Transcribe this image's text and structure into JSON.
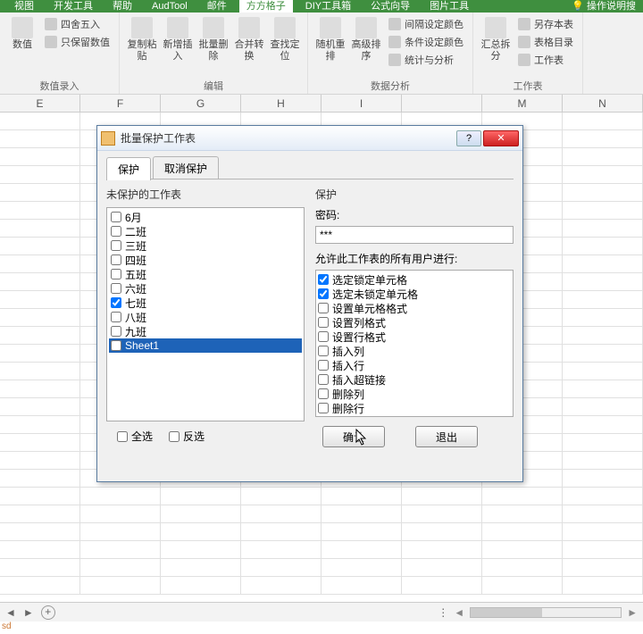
{
  "ribbon_tabs": {
    "t0": "视图",
    "t1": "开发工具",
    "t2": "帮助",
    "t3": "AudTool",
    "t4": "邮件",
    "t5": "方方格子",
    "t6": "DIY工具箱",
    "t7": "公式向导",
    "t8": "图片工具",
    "help": "操作说明搜"
  },
  "ribbon": {
    "g1": {
      "btn1": "数值",
      "r1": "四舍五入",
      "r2": "只保留数值",
      "label": "数值录入"
    },
    "g2": {
      "b1": "复制粘贴",
      "b2": "新增插入",
      "b3": "批量删除",
      "b4": "合并转换",
      "b5": "查找定位",
      "label": "编辑"
    },
    "g3": {
      "b1": "随机重排",
      "b2": "高级排序",
      "r1": "间隔设定颜色",
      "r2": "条件设定颜色",
      "r3": "统计与分析",
      "label": "数据分析"
    },
    "g4": {
      "b1": "汇总拆分",
      "r1": "另存本表",
      "r2": "表格目录",
      "r3": "工作表",
      "label": "工作表"
    }
  },
  "columns": {
    "c1": "E",
    "c2": "F",
    "c3": "G",
    "c4": "H",
    "c5": "I",
    "c6": "M",
    "c7": "N"
  },
  "dialog": {
    "title": "批量保护工作表",
    "tab_protect": "保护",
    "tab_unprotect": "取消保护",
    "left_title": "未保护的工作表",
    "sheets": {
      "s0": "6月",
      "s1": "二班",
      "s2": "三班",
      "s3": "四班",
      "s4": "五班",
      "s5": "六班",
      "s6": "七班",
      "s7": "八班",
      "s8": "九班",
      "s9": "Sheet1"
    },
    "checked_sheet": "七班",
    "selected_sheet": "Sheet1",
    "select_all": "全选",
    "invert": "反选",
    "right_title": "保护",
    "pwd_label": "密码:",
    "pwd_value": "***",
    "perm_label": "允许此工作表的所有用户进行:",
    "perms": {
      "p0": "选定锁定单元格",
      "p1": "选定未锁定单元格",
      "p2": "设置单元格格式",
      "p3": "设置列格式",
      "p4": "设置行格式",
      "p5": "插入列",
      "p6": "插入行",
      "p7": "插入超链接",
      "p8": "删除列",
      "p9": "删除行"
    },
    "ok": "确认",
    "exit": "退出",
    "help": "?",
    "close": "✕"
  },
  "status": "sd"
}
